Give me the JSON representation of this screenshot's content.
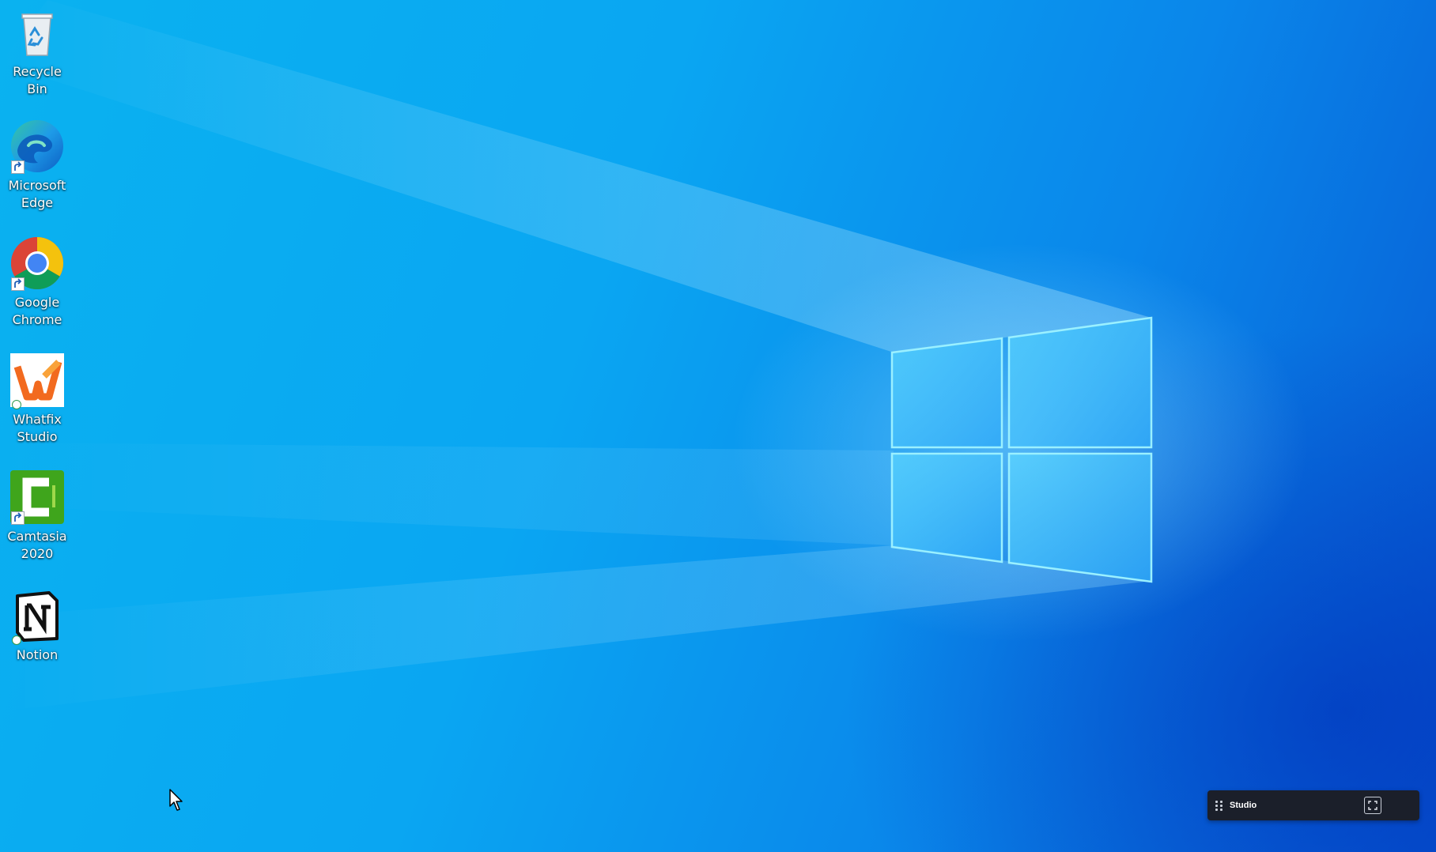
{
  "desktop": {
    "icons": [
      {
        "label": "Recycle Bin",
        "icon": "recycle-bin-icon"
      },
      {
        "label": "Microsoft Edge",
        "icon": "microsoft-edge-icon"
      },
      {
        "label": "Google Chrome",
        "icon": "google-chrome-icon"
      },
      {
        "label": "Whatfix Studio",
        "icon": "whatfix-studio-icon"
      },
      {
        "label": "Camtasia 2020",
        "icon": "camtasia-icon"
      },
      {
        "label": "Notion",
        "icon": "notion-icon"
      }
    ]
  },
  "studio_widget": {
    "label": "Studio",
    "drag_icon": "drag-handle-icon",
    "expand_icon": "expand-icon"
  },
  "colors": {
    "wallpaper_blue": "#0a86ea",
    "widget_bg": "#1b1f2a",
    "whatfix_orange": "#f26a1f",
    "camtasia_green": "#3fa51c"
  }
}
